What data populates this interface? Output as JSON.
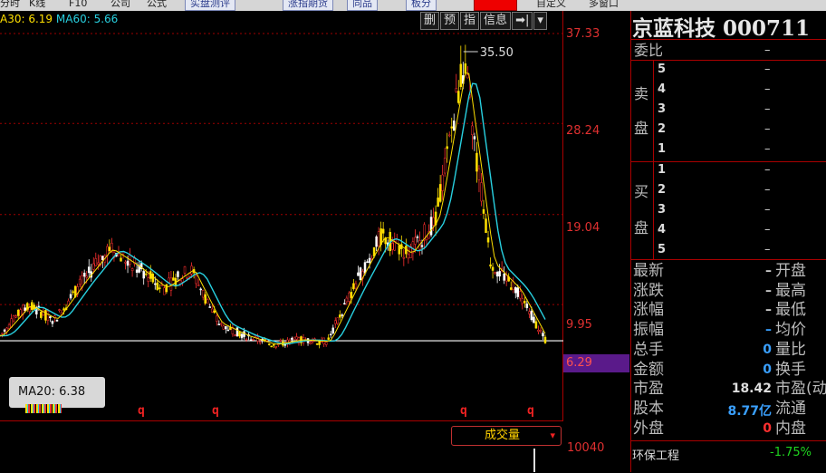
{
  "menu": {
    "items": [
      "分时",
      "K线",
      "F10",
      "公司",
      "公式"
    ],
    "buttons": [
      "实盘测评",
      "涨指期货",
      "同品",
      "板分"
    ],
    "right": [
      "自定义",
      "多窗口"
    ]
  },
  "chart": {
    "ma_legend": {
      "ma30": "A30: 6.19",
      "ma60": "MA60: 5.66"
    },
    "tools": [
      "删",
      "预",
      "指",
      "信息",
      "➡|",
      "▾"
    ],
    "y_labels": [
      "37.33",
      "28.24",
      "19.04",
      "9.95"
    ],
    "price_tag": "6.29",
    "peak_label": "35.50",
    "ma20_tip": "MA20: 6.38",
    "q_marks": [
      "q",
      "q",
      "q",
      "q"
    ],
    "volume_button": "成交量",
    "volume_arrow": "▾",
    "volume_axis": "10040"
  },
  "chart_data": {
    "type": "line",
    "x": [
      0,
      5,
      10,
      15,
      20,
      25,
      30,
      35,
      40,
      45,
      50,
      55,
      60,
      65,
      70,
      75,
      80,
      85,
      90,
      95,
      100
    ],
    "y": [
      6.8,
      9.9,
      8.4,
      12.2,
      15.6,
      13.8,
      11.6,
      13.5,
      8.1,
      6.8,
      5.9,
      6.4,
      6.2,
      11.8,
      16.9,
      15.1,
      18.6,
      34.5,
      14.2,
      11.4,
      6.3
    ],
    "peak": 35.5,
    "ylim": [
      3.0,
      37.33
    ]
  },
  "stock": {
    "name": "京蓝科技",
    "code": "000711"
  },
  "orderbook": {
    "weibi_label": "委比",
    "weibi_value": "–",
    "sell_label": [
      "卖",
      "盘"
    ],
    "buy_label": [
      "买",
      "盘"
    ],
    "sell_levels": [
      "5",
      "4",
      "3",
      "2",
      "1"
    ],
    "buy_levels": [
      "1",
      "2",
      "3",
      "4",
      "5"
    ],
    "dash": "–"
  },
  "quote": {
    "rows": [
      {
        "left": "最新",
        "value": "–",
        "vcolor": "#cccccc",
        "right": "开盘"
      },
      {
        "left": "涨跌",
        "value": "–",
        "vcolor": "#cccccc",
        "right": "最高"
      },
      {
        "left": "涨幅",
        "value": "–",
        "vcolor": "#cccccc",
        "right": "最低"
      },
      {
        "left": "振幅",
        "value": "–",
        "vcolor": "#3aa0ff",
        "right": "均价"
      },
      {
        "left": "总手",
        "value": "0",
        "vcolor": "#3aa0ff",
        "right": "量比"
      },
      {
        "left": "金额",
        "value": "0",
        "vcolor": "#3aa0ff",
        "right": "换手"
      },
      {
        "left": "市盈",
        "value": "18.42",
        "vcolor": "#dddddd",
        "right": "市盈(动)"
      },
      {
        "left": "股本",
        "value": "8.77亿",
        "vcolor": "#3aa0ff",
        "right": "流通"
      },
      {
        "left": "外盘",
        "value": "0",
        "vcolor": "#ff3030",
        "right": "内盘"
      }
    ]
  },
  "sector": {
    "name": "环保工程",
    "change": "-1.75%"
  },
  "colors": {
    "up": "#ff3030",
    "down": "#1fd41f",
    "grid": "#a00000",
    "ma_cyan": "#28d0e0",
    "ma_yellow": "#ffe000"
  }
}
